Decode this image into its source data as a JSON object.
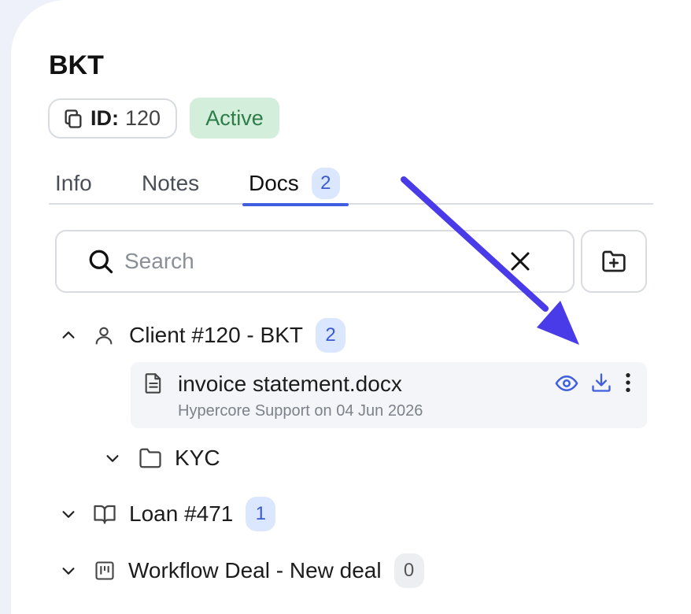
{
  "header": {
    "title": "BKT",
    "id_key": "ID:",
    "id_value": "120",
    "status": "Active"
  },
  "tabs": [
    {
      "label": "Info"
    },
    {
      "label": "Notes"
    },
    {
      "label": "Docs",
      "count": "2",
      "active": true
    }
  ],
  "search": {
    "placeholder": "Search",
    "value": ""
  },
  "tree": {
    "client": {
      "label": "Client #120 - BKT",
      "count": "2",
      "expanded": true
    },
    "document": {
      "name": "invoice statement.docx",
      "meta": "Hypercore Support on 04 Jun 2026"
    },
    "kyc": {
      "label": "KYC"
    },
    "loan": {
      "label": "Loan #471",
      "count": "1"
    },
    "workflow": {
      "label": "Workflow Deal - New deal",
      "count": "0"
    }
  },
  "colors": {
    "accent": "#3f5fe0",
    "arrow": "#4a3be8",
    "active_badge_bg": "#d3eedb",
    "active_badge_text": "#2e7d49",
    "count_badge_bg": "#dbe6ff"
  },
  "icons": {
    "copy": "copy-icon",
    "search": "search-icon",
    "clear": "close-icon",
    "new_folder": "folder-plus-icon",
    "person": "user-icon",
    "document": "document-icon",
    "view": "eye-icon",
    "download": "download-icon",
    "more": "more-vertical-icon",
    "folder": "folder-icon",
    "book": "book-icon",
    "board": "kanban-icon"
  }
}
